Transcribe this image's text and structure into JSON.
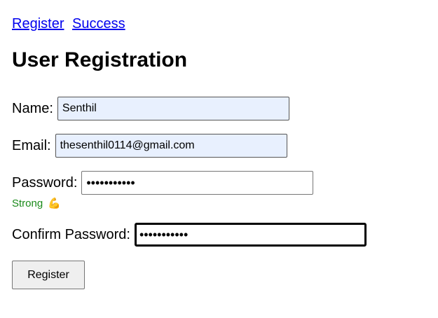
{
  "nav": {
    "register_link": "Register",
    "success_link": "Success"
  },
  "page_title": "User Registration",
  "form": {
    "name": {
      "label": "Name:",
      "value": "Senthil"
    },
    "email": {
      "label": "Email:",
      "value": "thesenthil0114@gmail.com"
    },
    "password": {
      "label": "Password:",
      "value": "•••••••••••"
    },
    "password_strength": {
      "text": "Strong",
      "emoji": "💪",
      "color": "#1a8a1a"
    },
    "confirm_password": {
      "label": "Confirm Password:",
      "value": "•••••••••••"
    },
    "submit_label": "Register"
  },
  "colors": {
    "link": "#0000ee",
    "autofill_bg": "#e8f0fe",
    "button_bg": "#efefef"
  }
}
